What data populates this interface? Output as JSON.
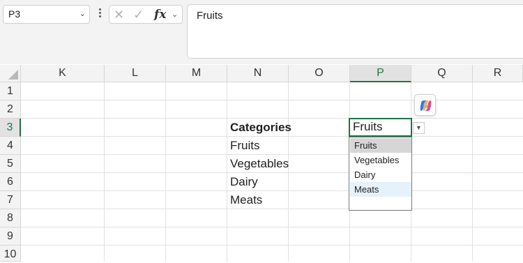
{
  "formula_bar": {
    "name_box": "P3",
    "formula": "Fruits",
    "icons": [
      "cancel-icon",
      "enter-check-icon",
      "insert-function-icon"
    ],
    "fx_label": "fx"
  },
  "columns": [
    "K",
    "L",
    "M",
    "N",
    "O",
    "P",
    "Q",
    "R"
  ],
  "selected_column": "P",
  "rows": [
    "1",
    "2",
    "3",
    "4",
    "5",
    "6",
    "7",
    "8",
    "9",
    "10"
  ],
  "selected_row": "3",
  "cells": {
    "N3": "Categories",
    "N4": "Fruits",
    "N5": "Vegetables",
    "N6": "Dairy",
    "N7": "Meats",
    "P3": "Fruits"
  },
  "dropdown": {
    "options": [
      "Fruits",
      "Vegetables",
      "Dairy",
      "Meats"
    ],
    "selected": "Fruits",
    "hovered": "Meats"
  },
  "copilot_icon": "copilot-icon",
  "colors": {
    "accent": "#217346",
    "header_bg": "#f3f3f3",
    "gridline": "#e1e1e1",
    "hover": "#e5f1fb"
  }
}
